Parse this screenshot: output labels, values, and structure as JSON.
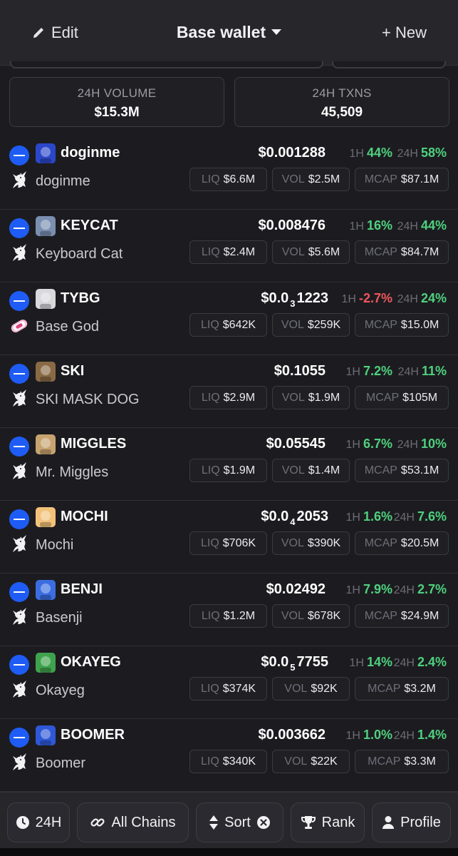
{
  "header": {
    "edit_label": "Edit",
    "wallet_title": "Base wallet",
    "new_label": "+ New"
  },
  "stats": {
    "volume_label": "24H VOLUME",
    "volume_value": "$15.3M",
    "txns_label": "24H TXNS",
    "txns_value": "45,509"
  },
  "labels": {
    "h1": "1H",
    "h24": "24H",
    "liq": "LIQ",
    "vol": "VOL",
    "mcap": "MCAP"
  },
  "tokens": [
    {
      "symbol": "doginme",
      "name": "doginme",
      "price_a": "$0.001288",
      "price_sub": "",
      "price_b": "",
      "h1": "44%",
      "h1_dir": "pos",
      "h24": "58%",
      "h24_dir": "pos",
      "liq": "$6.6M",
      "vol": "$2.5M",
      "mcap": "$87.1M",
      "avatar_color": "#2b47c9",
      "dex_icon": "unicorn-icon"
    },
    {
      "symbol": "KEYCAT",
      "name": "Keyboard Cat",
      "price_a": "$0.008476",
      "price_sub": "",
      "price_b": "",
      "h1": "16%",
      "h1_dir": "pos",
      "h24": "44%",
      "h24_dir": "pos",
      "liq": "$2.4M",
      "vol": "$5.6M",
      "mcap": "$84.7M",
      "avatar_color": "#7a8fb0",
      "dex_icon": "unicorn-icon"
    },
    {
      "symbol": "TYBG",
      "name": "Base God",
      "price_a": "$0.0",
      "price_sub": "3",
      "price_b": "1223",
      "h1": "-2.7%",
      "h1_dir": "neg",
      "h24": "24%",
      "h24_dir": "pos",
      "liq": "$642K",
      "vol": "$259K",
      "mcap": "$15.0M",
      "avatar_color": "#d9d9dc",
      "dex_icon": "sushi-icon"
    },
    {
      "symbol": "SKI",
      "name": "SKI MASK DOG",
      "price_a": "$0.1055",
      "price_sub": "",
      "price_b": "",
      "h1": "7.2%",
      "h1_dir": "pos",
      "h24": "11%",
      "h24_dir": "pos",
      "liq": "$2.9M",
      "vol": "$1.9M",
      "mcap": "$105M",
      "avatar_color": "#8a6a45",
      "dex_icon": "unicorn-icon"
    },
    {
      "symbol": "MIGGLES",
      "name": "Mr. Miggles",
      "price_a": "$0.05545",
      "price_sub": "",
      "price_b": "",
      "h1": "6.7%",
      "h1_dir": "pos",
      "h24": "10%",
      "h24_dir": "pos",
      "liq": "$1.9M",
      "vol": "$1.4M",
      "mcap": "$53.1M",
      "avatar_color": "#c7a36f",
      "dex_icon": "unicorn-icon"
    },
    {
      "symbol": "MOCHI",
      "name": "Mochi",
      "price_a": "$0.0",
      "price_sub": "4",
      "price_b": "2053",
      "h1": "1.6%",
      "h1_dir": "pos",
      "h24": "7.6%",
      "h24_dir": "pos",
      "liq": "$706K",
      "vol": "$390K",
      "mcap": "$20.5M",
      "avatar_color": "#f2c27a",
      "dex_icon": "unicorn-icon"
    },
    {
      "symbol": "BENJI",
      "name": "Basenji",
      "price_a": "$0.02492",
      "price_sub": "",
      "price_b": "",
      "h1": "7.9%",
      "h1_dir": "pos",
      "h24": "2.7%",
      "h24_dir": "pos",
      "liq": "$1.2M",
      "vol": "$678K",
      "mcap": "$24.9M",
      "avatar_color": "#3b6de0",
      "dex_icon": "unicorn-icon"
    },
    {
      "symbol": "OKAYEG",
      "name": "Okayeg",
      "price_a": "$0.0",
      "price_sub": "5",
      "price_b": "7755",
      "h1": "14%",
      "h1_dir": "pos",
      "h24": "2.4%",
      "h24_dir": "pos",
      "liq": "$374K",
      "vol": "$92K",
      "mcap": "$3.2M",
      "avatar_color": "#3fa34d",
      "dex_icon": "unicorn-icon"
    },
    {
      "symbol": "BOOMER",
      "name": "Boomer",
      "price_a": "$0.003662",
      "price_sub": "",
      "price_b": "",
      "h1": "1.0%",
      "h1_dir": "pos",
      "h24": "1.4%",
      "h24_dir": "pos",
      "liq": "$340K",
      "vol": "$22K",
      "mcap": "$3.3M",
      "avatar_color": "#2f58d8",
      "dex_icon": "unicorn-icon"
    }
  ],
  "bottom": {
    "timeframe": "24H",
    "chains": "All Chains",
    "sort": "Sort",
    "rank": "Rank",
    "profile": "Profile"
  },
  "colors": {
    "background": "#1c1c20",
    "positive": "#4fd17e",
    "negative": "#f0565e",
    "chain_blue": "#1e5cf5"
  }
}
